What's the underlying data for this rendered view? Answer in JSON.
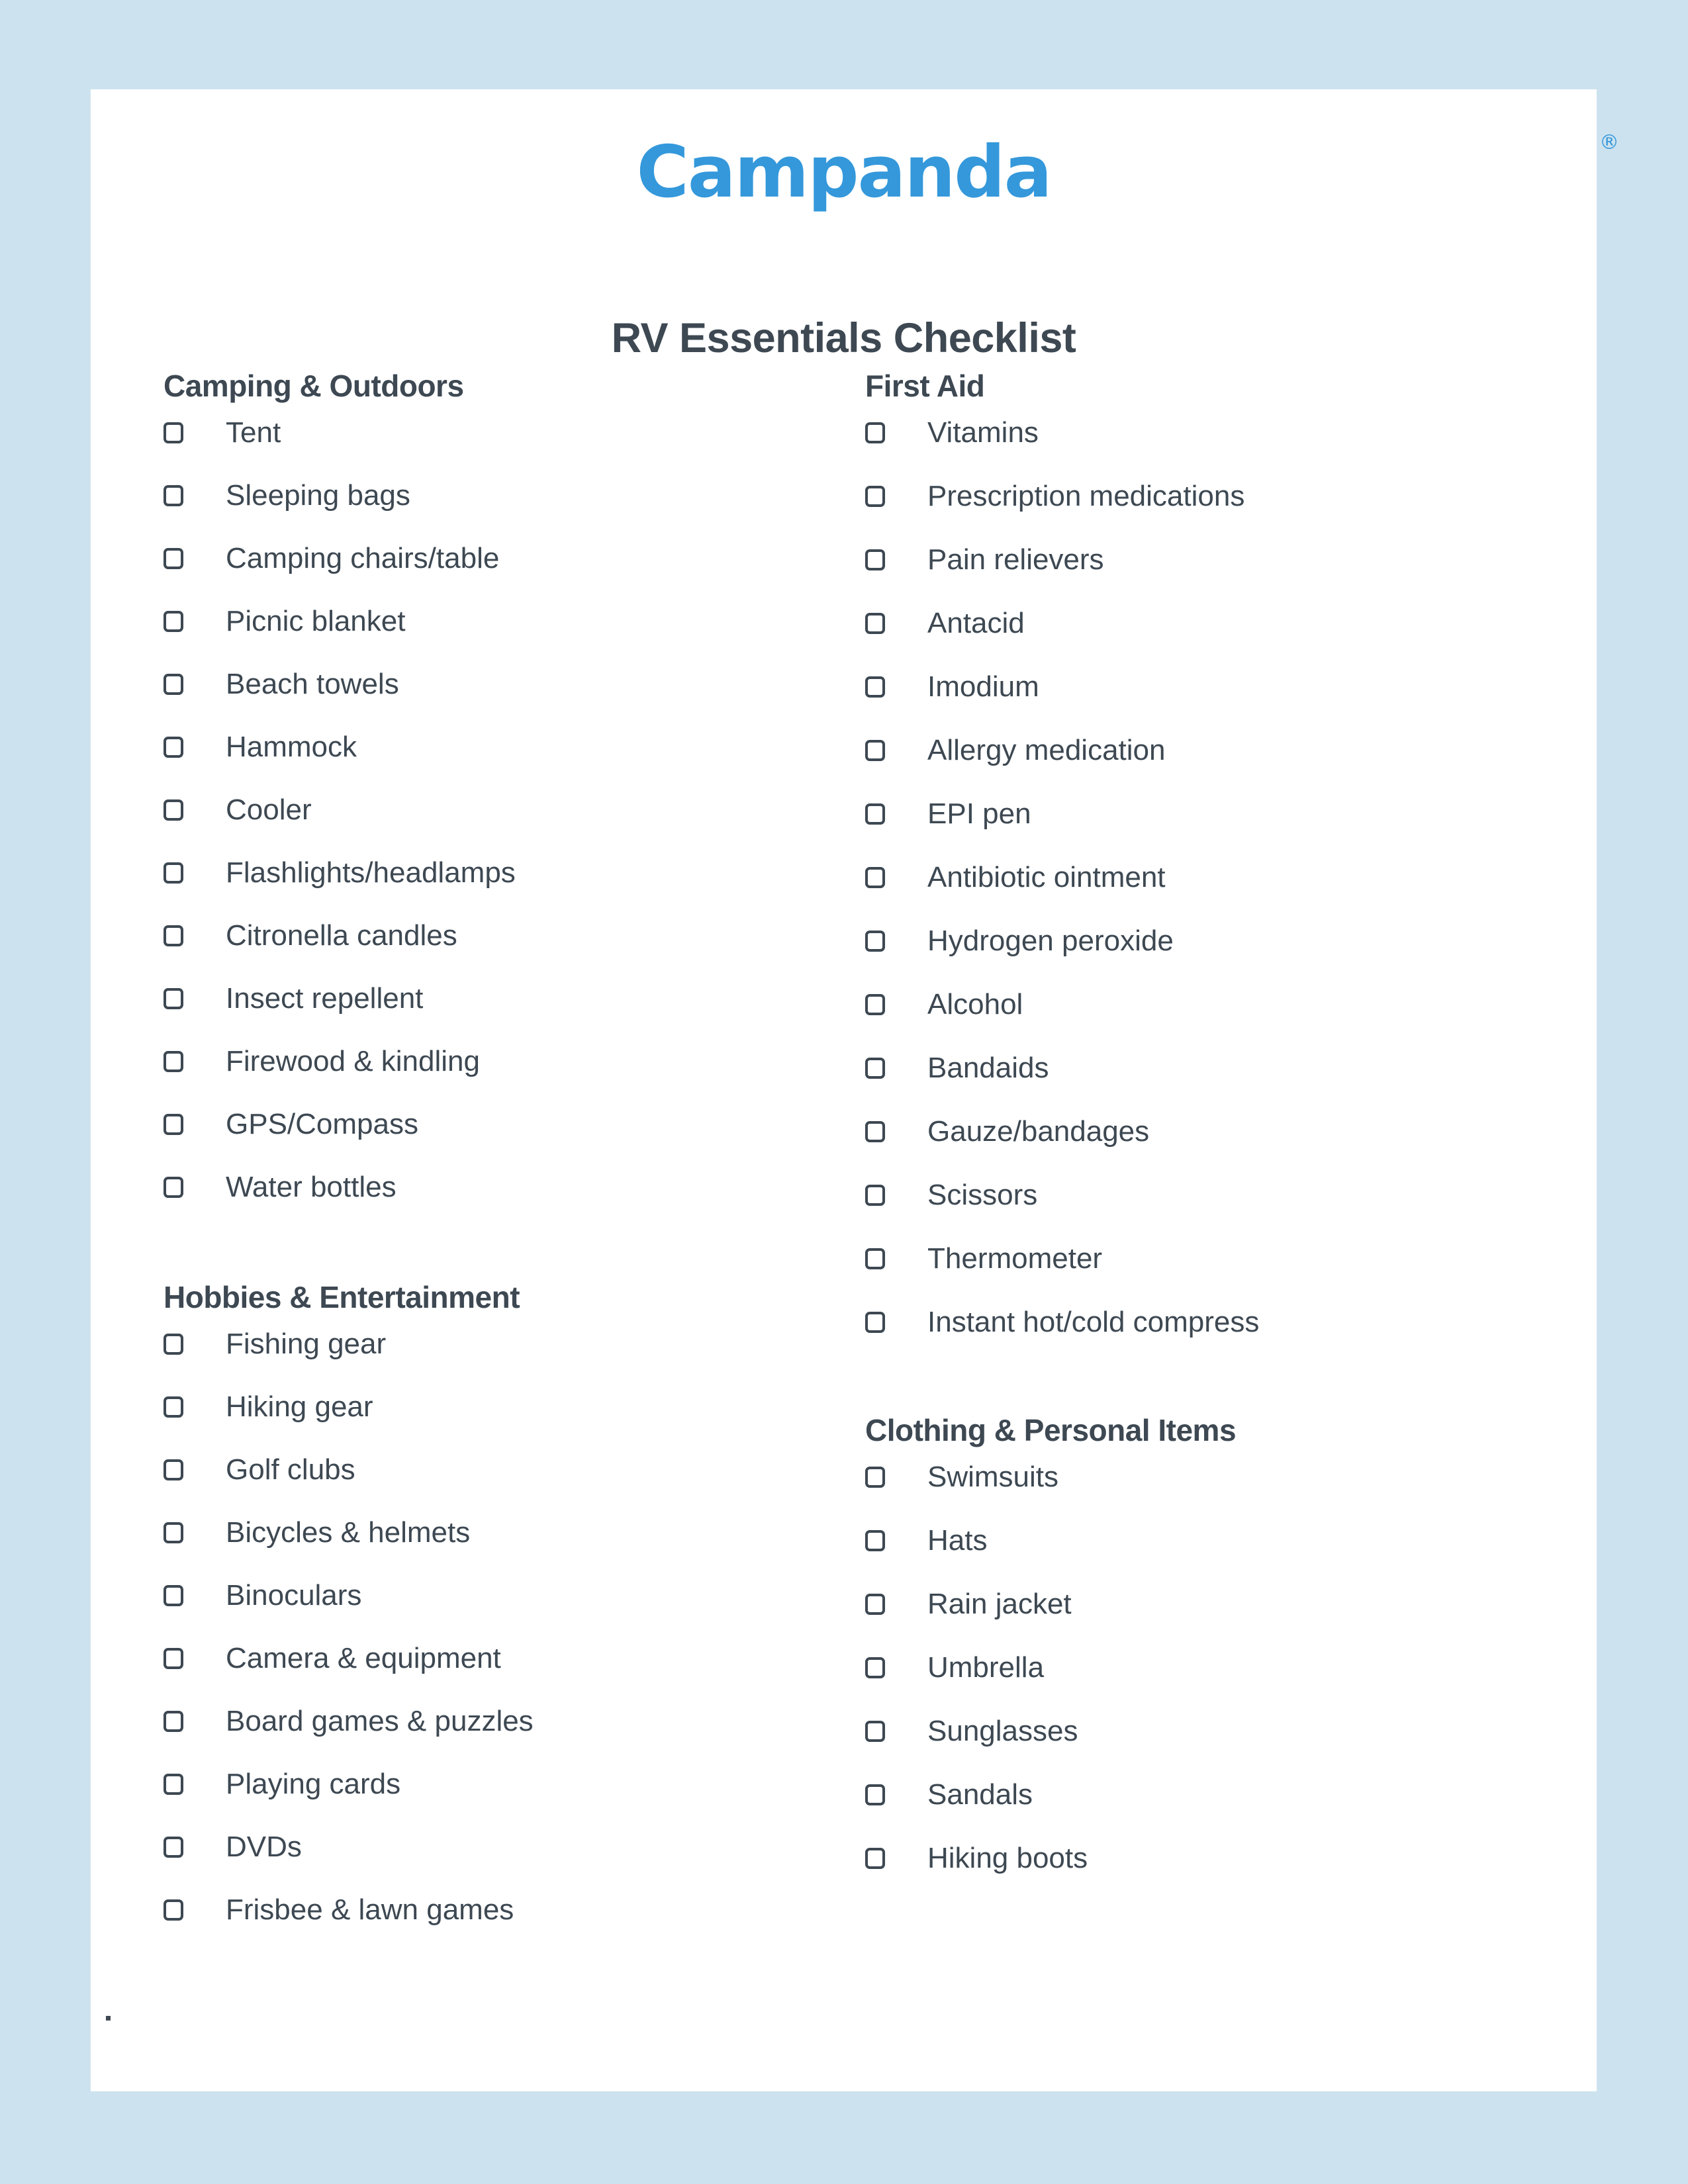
{
  "background_color": "#cde2ef",
  "page_color": "#ffffff",
  "brand": {
    "logo_text": "Campanda",
    "trademark_symbol": "®",
    "logo_color": "#3498db"
  },
  "document": {
    "title": "RV Essentials Checklist",
    "text_color": "#3d4852"
  },
  "columns": {
    "left": [
      {
        "title": "Camping & Outdoors",
        "items": [
          "Tent",
          "Sleeping bags",
          "Camping chairs/table",
          "Picnic blanket",
          "Beach towels",
          "Hammock",
          "Cooler",
          "Flashlights/headlamps",
          "Citronella candles",
          "Insect repellent",
          "Firewood & kindling",
          "GPS/Compass",
          "Water bottles"
        ]
      },
      {
        "title": "Hobbies & Entertainment",
        "items": [
          "Fishing gear",
          "Hiking gear",
          "Golf clubs",
          "Bicycles & helmets",
          "Binoculars",
          "Camera & equipment",
          "Board games & puzzles",
          "Playing cards",
          "DVDs",
          "Frisbee & lawn games"
        ]
      }
    ],
    "right": [
      {
        "title": "First Aid",
        "items": [
          "Vitamins",
          "Prescription medications",
          "Pain relievers",
          "Antacid",
          "Imodium",
          "Allergy medication",
          "EPI pen",
          "Antibiotic ointment",
          "Hydrogen peroxide",
          "Alcohol",
          "Bandaids",
          "Gauze/bandages",
          "Scissors",
          "Thermometer",
          "Instant hot/cold compress"
        ]
      },
      {
        "title": "Clothing & Personal Items",
        "items": [
          "Swimsuits",
          "Hats",
          "Rain jacket",
          "Umbrella",
          "Sunglasses",
          "Sandals",
          "Hiking boots"
        ]
      }
    ]
  }
}
